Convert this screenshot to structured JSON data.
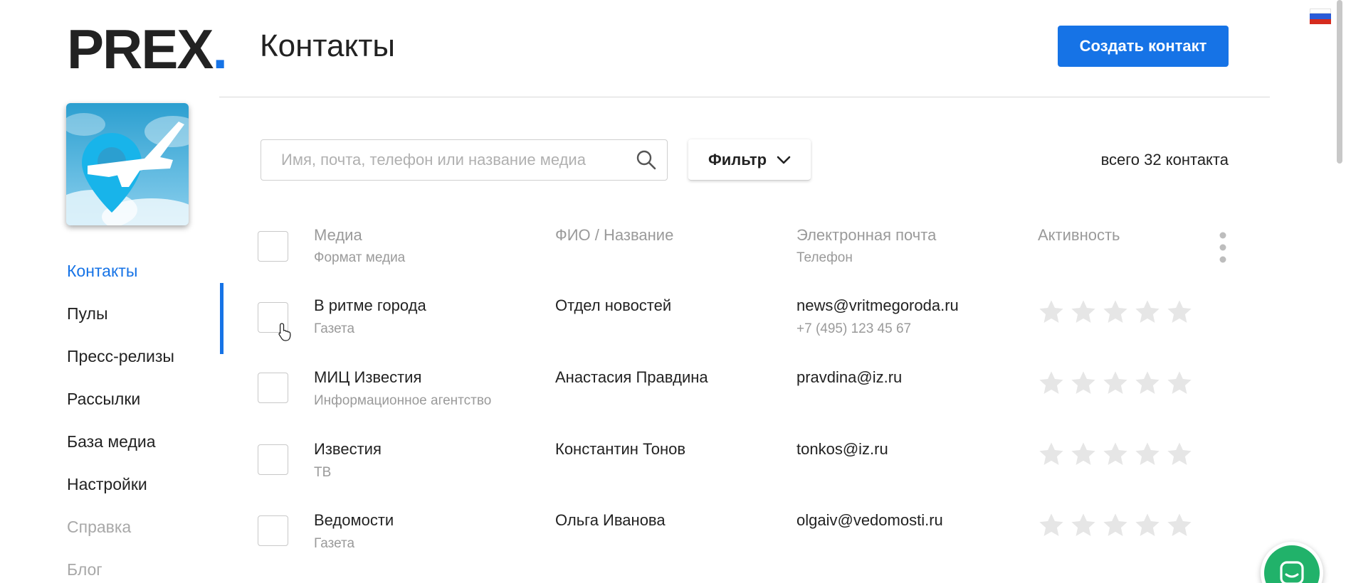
{
  "logo": {
    "text": "PREX",
    "dot": "."
  },
  "header": {
    "title": "Контакты",
    "create_button": "Создать контакт"
  },
  "nav": {
    "items": [
      {
        "label": "Контакты",
        "state": "active"
      },
      {
        "label": "Пулы",
        "state": "normal"
      },
      {
        "label": "Пресс-релизы",
        "state": "normal"
      },
      {
        "label": "Рассылки",
        "state": "normal"
      },
      {
        "label": "База медиа",
        "state": "normal"
      },
      {
        "label": "Настройки",
        "state": "normal"
      },
      {
        "label": "Справка",
        "state": "muted"
      },
      {
        "label": "Блог",
        "state": "muted"
      }
    ]
  },
  "search": {
    "placeholder": "Имя, почта, телефон или название медиа",
    "value": ""
  },
  "filter": {
    "label": "Фильтр"
  },
  "total": {
    "prefix": "всего ",
    "count": "32",
    "suffix": " контакта"
  },
  "table": {
    "headers": {
      "media": "Медиа",
      "media_format": "Формат медиа",
      "name": "ФИО / Название",
      "email": "Электронная почта",
      "phone": "Телефон",
      "activity": "Активность"
    },
    "rows": [
      {
        "media": "В ритме города",
        "format": "Газета",
        "name": "Отдел новостей",
        "email": "news@vritmegoroda.ru",
        "phone": "+7 (495) 123 45 67",
        "rating": 0
      },
      {
        "media": "МИЦ Известия",
        "format": "Информационное агентство",
        "name": "Анастасия Правдина",
        "email": "pravdina@iz.ru",
        "phone": "",
        "rating": 0
      },
      {
        "media": "Известия",
        "format": "ТВ",
        "name": "Константин Тонов",
        "email": "tonkos@iz.ru",
        "phone": "",
        "rating": 0
      },
      {
        "media": "Ведомости",
        "format": "Газета",
        "name": "Ольга Иванова",
        "email": "olgaiv@vedomosti.ru",
        "phone": "",
        "rating": 0
      }
    ]
  },
  "colors": {
    "accent": "#1673e6",
    "muted_text": "#9a9a9a",
    "star_empty": "#e6e6e6",
    "chat_green": "#21b26a"
  },
  "icons": {
    "search": "search-icon",
    "filter_chevron": "chevron-down-icon",
    "more": "kebab-menu-icon",
    "rating": "star-icon",
    "language": "russian-flag-icon",
    "chat": "chat-icon"
  }
}
